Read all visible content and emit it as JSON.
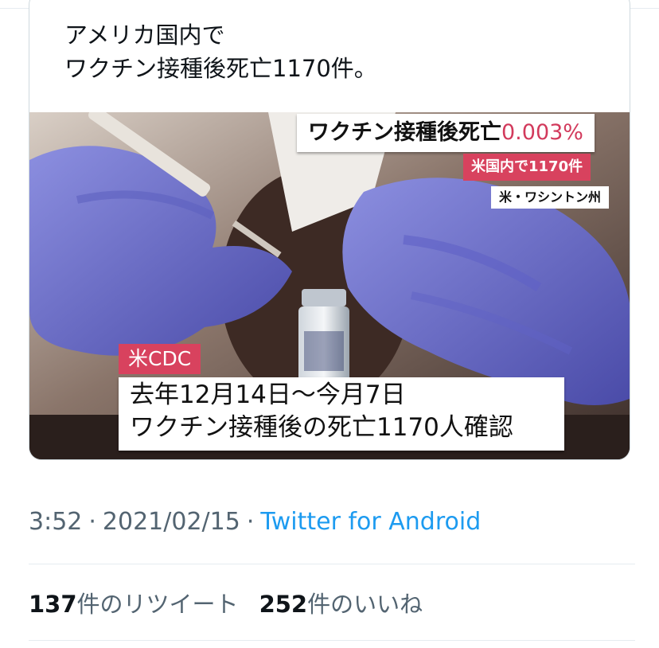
{
  "quoted_tweet": {
    "text": "アメリカ国内で\nワクチン接種後死亡1170件。"
  },
  "media_captions": {
    "main": "ワクチン接種後死亡",
    "main_percent": "0.003%",
    "sub": "米国内で1170件",
    "location": "米・ワシントン州",
    "source_tag": "米CDC",
    "bottom": "去年12月14日～今月7日\nワクチン接種後の死亡1170人確認"
  },
  "meta": {
    "time": "3:52",
    "date": "2021/02/15",
    "separator": "·",
    "source": "Twitter for Android"
  },
  "stats": {
    "retweets_count": "137",
    "retweets_label": "件のリツイート",
    "likes_count": "252",
    "likes_label": "件のいいね"
  },
  "colors": {
    "accent_link": "#1d9bf0",
    "caption_red": "#d8425e",
    "meta_gray": "#536471"
  }
}
